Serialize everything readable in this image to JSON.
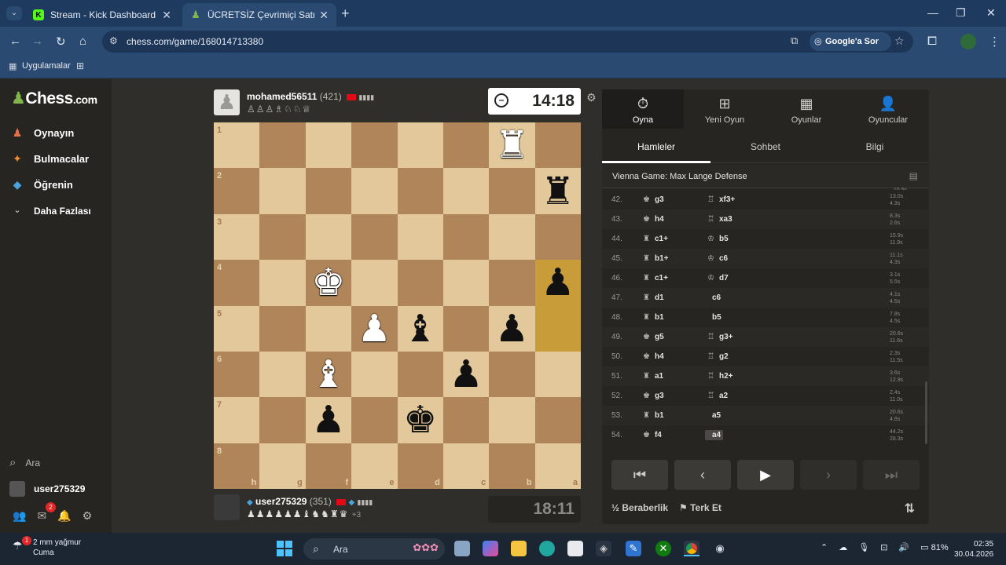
{
  "browser": {
    "tabs": [
      {
        "title": "Stream - Kick Dashboard",
        "icon": "kick-icon"
      },
      {
        "title": "ÜCRETSİZ Çevrimiçi Satranç Oy",
        "icon": "chess-pawn-icon"
      }
    ],
    "url": "chess.com/game/168014713380",
    "google_ask": "Google'a Sor",
    "bookmarks_apps": "Uygulamalar"
  },
  "sidebar": {
    "logo_main": "Chess",
    "logo_suffix": ".com",
    "items": [
      {
        "label": "Oynayın",
        "icon": "play-pawn-icon"
      },
      {
        "label": "Bulmacalar",
        "icon": "puzzle-icon"
      },
      {
        "label": "Öğrenin",
        "icon": "learn-cap-icon"
      },
      {
        "label": "Daha Fazlası",
        "icon": "chevron-down-icon"
      }
    ],
    "search_label": "Ara",
    "username": "user275329",
    "notif_count": "2"
  },
  "top_player": {
    "name": "mohamed56511",
    "rating": "(421)",
    "captured": "♙♙♙♗♘♘♕",
    "clock": "14:18"
  },
  "bottom_player": {
    "name": "user275329",
    "rating": "(351)",
    "captured": "♟♟♟♟♟♟♝♞♞♜♛",
    "advantage": "+3",
    "clock": "18:11"
  },
  "board": {
    "orientation": "black",
    "rank_labels": [
      "1",
      "2",
      "3",
      "4",
      "5",
      "6",
      "7",
      "8"
    ],
    "file_labels": [
      "h",
      "g",
      "f",
      "e",
      "d",
      "c",
      "b",
      "a"
    ],
    "highlight": [
      "a4",
      "a5"
    ],
    "pieces": {
      "b1": "wR",
      "a2": "bR",
      "a4": "bP",
      "f4": "wK",
      "e5": "wP",
      "d5": "bB",
      "b5": "bP",
      "f6": "wB",
      "c6": "bP",
      "f7": "bP",
      "d7": "bK"
    }
  },
  "panel": {
    "top_tabs": [
      {
        "label": "Oyna",
        "icon": "stopwatch-icon"
      },
      {
        "label": "Yeni Oyun",
        "icon": "plus-square-icon"
      },
      {
        "label": "Oyunlar",
        "icon": "board-grid-icon"
      },
      {
        "label": "Oyuncular",
        "icon": "players-icon"
      }
    ],
    "sub_tabs": [
      "Hamleler",
      "Sohbet",
      "Bilgi"
    ],
    "opening": "Vienna Game: Max Lange Defense",
    "top_time_fragment": "10.5s",
    "moves": [
      {
        "no": "42.",
        "w_icon": "♚",
        "w": "g3",
        "b_icon": "♖",
        "b": "xf3+",
        "tw": "13.0s",
        "tb": "4.3s"
      },
      {
        "no": "43.",
        "w_icon": "♚",
        "w": "h4",
        "b_icon": "♖",
        "b": "xa3",
        "tw": "8.3s",
        "tb": "2.6s"
      },
      {
        "no": "44.",
        "w_icon": "♜",
        "w": "c1+",
        "b_icon": "♔",
        "b": "b5",
        "tw": "15.9s",
        "tb": "11.9s"
      },
      {
        "no": "45.",
        "w_icon": "♜",
        "w": "b1+",
        "b_icon": "♔",
        "b": "c6",
        "tw": "11.1s",
        "tb": "4.3s"
      },
      {
        "no": "46.",
        "w_icon": "♜",
        "w": "c1+",
        "b_icon": "♔",
        "b": "d7",
        "tw": "3.1s",
        "tb": "5.5s"
      },
      {
        "no": "47.",
        "w_icon": "♜",
        "w": "d1",
        "b_icon": "",
        "b": "c6",
        "tw": "4.1s",
        "tb": "4.5s"
      },
      {
        "no": "48.",
        "w_icon": "♜",
        "w": "b1",
        "b_icon": "",
        "b": "b5",
        "tw": "7.8s",
        "tb": "4.5s"
      },
      {
        "no": "49.",
        "w_icon": "♚",
        "w": "g5",
        "b_icon": "♖",
        "b": "g3+",
        "tw": "20.6s",
        "tb": "11.6s"
      },
      {
        "no": "50.",
        "w_icon": "♚",
        "w": "h4",
        "b_icon": "♖",
        "b": "g2",
        "tw": "2.3s",
        "tb": "11.5s"
      },
      {
        "no": "51.",
        "w_icon": "♜",
        "w": "a1",
        "b_icon": "♖",
        "b": "h2+",
        "tw": "3.6s",
        "tb": "12.9s"
      },
      {
        "no": "52.",
        "w_icon": "♚",
        "w": "g3",
        "b_icon": "♖",
        "b": "a2",
        "tw": "2.4s",
        "tb": "11.0s"
      },
      {
        "no": "53.",
        "w_icon": "♜",
        "w": "b1",
        "b_icon": "",
        "b": "a5",
        "tw": "20.6s",
        "tb": "4.6s"
      },
      {
        "no": "54.",
        "w_icon": "♚",
        "w": "f4",
        "b_icon": "",
        "b": "a4",
        "tw": "44.2s",
        "tb": "28.3s",
        "current": true
      }
    ],
    "draw_label": "Beraberlik",
    "draw_icon_text": "½",
    "resign_label": "Terk Et"
  },
  "taskbar": {
    "weather_line1": "2 mm yağmur",
    "weather_line2": "Cuma",
    "weather_badge": "1",
    "search": "Ara",
    "battery": "81%",
    "time": "02:35",
    "date": "30.04.2026"
  },
  "colors": {
    "accent_green": "#81b64c",
    "board_light": "#e2c89a",
    "board_dark": "#b0855a",
    "highlight": "#c99c3a"
  }
}
